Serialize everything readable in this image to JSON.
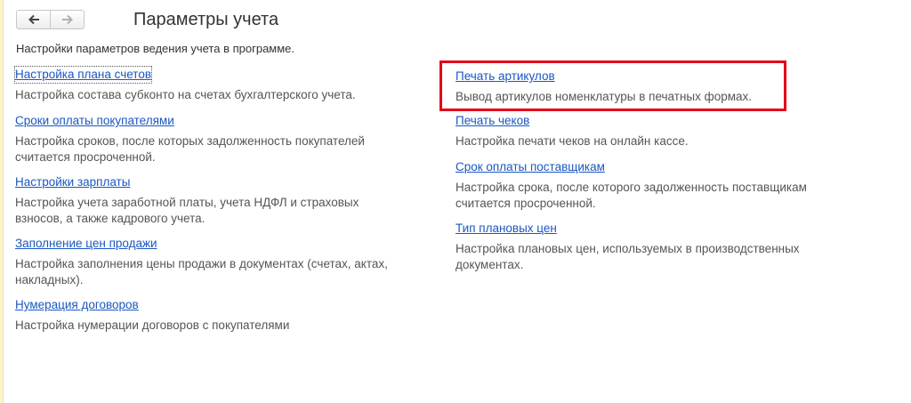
{
  "nav": {
    "back_icon": "arrow-left-icon",
    "forward_icon": "arrow-right-icon"
  },
  "header": {
    "title": "Параметры учета",
    "subtitle": "Настройки параметров ведения учета в программе."
  },
  "left_column": [
    {
      "link": "Настройка плана счетов",
      "description": "Настройка состава субконто на счетах бухгалтерского учета."
    },
    {
      "link": "Сроки оплаты покупателями",
      "description": "Настройка сроков, после которых задолженность покупателей считается просроченной."
    },
    {
      "link": "Настройки зарплаты",
      "description": "Настройка учета заработной платы, учета НДФЛ и страховых взносов, а также кадрового учета."
    },
    {
      "link": "Заполнение цен продажи",
      "description": "Настройка заполнения цены продажи в документах (счетах, актах, накладных)."
    },
    {
      "link": "Нумерация договоров",
      "description": "Настройка нумерации договоров с покупателями"
    }
  ],
  "right_column": [
    {
      "link": "Печать артикулов",
      "description": "Вывод артикулов номенклатуры в печатных формах."
    },
    {
      "link": "Печать чеков",
      "description": "Настройка печати чеков на онлайн кассе."
    },
    {
      "link": "Срок оплаты поставщикам",
      "description": "Настройка срока, после которого задолженность поставщикам считается просроченной."
    },
    {
      "link": "Тип плановых цен",
      "description": "Настройка плановых цен, используемых в производственных документах."
    }
  ],
  "colors": {
    "link": "#1a57c1",
    "description": "#555555",
    "highlight": "#e2001a"
  }
}
